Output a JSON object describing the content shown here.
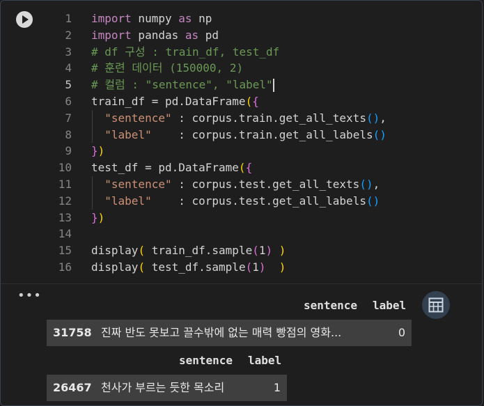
{
  "code_lines": [
    [
      [
        "kw",
        "import"
      ],
      [
        "t",
        " numpy "
      ],
      [
        "kw",
        "as"
      ],
      [
        "t",
        " np"
      ]
    ],
    [
      [
        "kw",
        "import"
      ],
      [
        "t",
        " pandas "
      ],
      [
        "kw",
        "as"
      ],
      [
        "t",
        " pd"
      ]
    ],
    [
      [
        "cm",
        "# df 구성 : train_df, test_df"
      ]
    ],
    [
      [
        "cm",
        "# 훈련 데이터 (150000, 2)"
      ]
    ],
    [
      [
        "cm",
        "# 컬럼 : \"sentence\", \"label\""
      ]
    ],
    [
      [
        "t",
        "train_df = pd.DataFrame"
      ],
      [
        "p1",
        "("
      ],
      [
        "p2",
        "{"
      ]
    ],
    [
      [
        "t",
        "  "
      ],
      [
        "st",
        "\"sentence\""
      ],
      [
        "t",
        " : corpus.train.get_all_texts"
      ],
      [
        "p3",
        "()"
      ],
      [
        "t",
        ","
      ]
    ],
    [
      [
        "t",
        "  "
      ],
      [
        "st",
        "\"label\""
      ],
      [
        "t",
        "    : corpus.train.get_all_labels"
      ],
      [
        "p3",
        "()"
      ]
    ],
    [
      [
        "p2",
        "}"
      ],
      [
        "p1",
        ")"
      ]
    ],
    [
      [
        "t",
        "test_df = pd.DataFrame"
      ],
      [
        "p1",
        "("
      ],
      [
        "p2",
        "{"
      ]
    ],
    [
      [
        "t",
        "  "
      ],
      [
        "st",
        "\"sentence\""
      ],
      [
        "t",
        " : corpus.test.get_all_texts"
      ],
      [
        "p3",
        "()"
      ],
      [
        "t",
        ","
      ]
    ],
    [
      [
        "t",
        "  "
      ],
      [
        "st",
        "\"label\""
      ],
      [
        "t",
        "    : corpus.test.get_all_labels"
      ],
      [
        "p3",
        "()"
      ]
    ],
    [
      [
        "p2",
        "}"
      ],
      [
        "p1",
        ")"
      ]
    ],
    [
      [
        "t",
        ""
      ]
    ],
    [
      [
        "t",
        "display"
      ],
      [
        "p1",
        "("
      ],
      [
        "t",
        " train_df.sample"
      ],
      [
        "p2",
        "("
      ],
      [
        "t",
        "1"
      ],
      [
        "p2",
        ")"
      ],
      [
        "t",
        " "
      ],
      [
        "p1",
        ")"
      ]
    ],
    [
      [
        "t",
        "display"
      ],
      [
        "p1",
        "("
      ],
      [
        "t",
        " test_df.sample"
      ],
      [
        "p2",
        "("
      ],
      [
        "t",
        "1"
      ],
      [
        "p2",
        ")"
      ],
      [
        "t",
        "  "
      ],
      [
        "p1",
        ")"
      ]
    ]
  ],
  "line_numbers": [
    "1",
    "2",
    "3",
    "4",
    "5",
    "6",
    "7",
    "8",
    "9",
    "10",
    "11",
    "12",
    "13",
    "14",
    "15",
    "16"
  ],
  "active_line": 4,
  "output": {
    "table1": {
      "col_sentence": "sentence",
      "col_label": "label",
      "index": "31758",
      "sentence": "진짜 반도 못보고 끌수밖에 없는 매력 빵점의 영화...",
      "label": "0"
    },
    "table2": {
      "col_sentence": "sentence",
      "col_label": "label",
      "index": "26467",
      "sentence": "천사가 부르는 듯한 목소리",
      "label": "1"
    }
  },
  "icons": {
    "run": "play-icon",
    "more": "more-horizontal-icon",
    "table": "table-icon"
  }
}
